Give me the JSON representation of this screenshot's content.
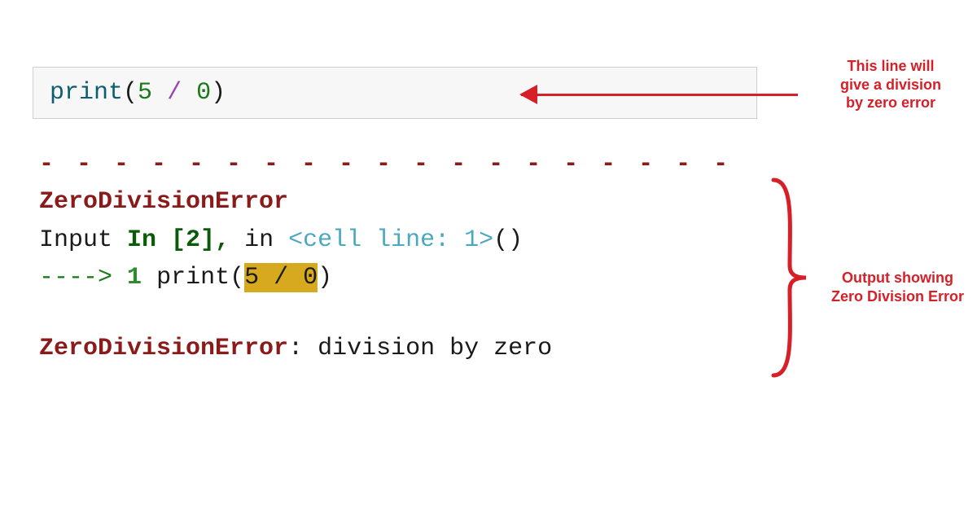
{
  "code": {
    "func": "print",
    "lparen": "(",
    "num1": "5",
    "op": "/",
    "num2": "0",
    "rparen": ")"
  },
  "separator": "- - - - - - - - - - - - - - - - - - - - - - - - - - - - - - - - - - - - - - -",
  "error": {
    "name": "ZeroDivisionError",
    "input_word": "Input",
    "in_word": "In [2]",
    "comma": ",",
    "in2": "in",
    "cell_line": "<cell line: 1>",
    "parens": "()",
    "arrow": "---->",
    "line_num": "1",
    "print_call_pre": "print(",
    "highlighted": "5 / 0",
    "print_call_post": ")",
    "final_name": "ZeroDivisionError",
    "colon": ":",
    "message": "division by zero"
  },
  "annotations": {
    "line1_a": "This line will",
    "line1_b": "give a division",
    "line1_c": "by zero error",
    "line2_a": "Output showing",
    "line2_b": "Zero Division Error"
  }
}
